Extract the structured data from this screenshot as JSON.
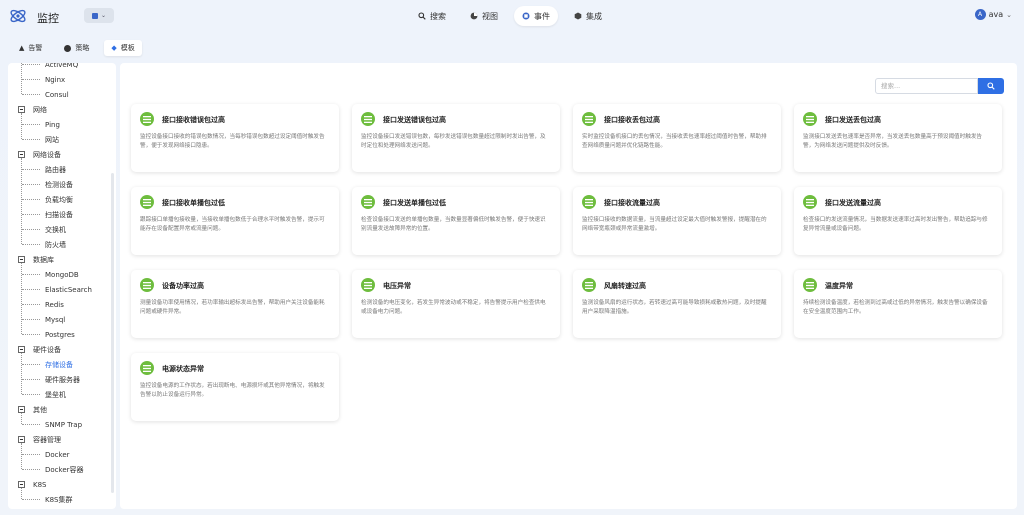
{
  "app": {
    "title": "监控",
    "user_initial": "A",
    "user_name": "ava"
  },
  "nav": [
    {
      "label": "搜索",
      "icon": "search-icon"
    },
    {
      "label": "视图",
      "icon": "chart-pie-icon"
    },
    {
      "label": "事件",
      "icon": "event-icon",
      "active": true
    },
    {
      "label": "集成",
      "icon": "cube-icon"
    }
  ],
  "subtabs": [
    {
      "label": "告警",
      "icon": "bell-icon"
    },
    {
      "label": "策略",
      "icon": "policy-icon"
    },
    {
      "label": "模板",
      "icon": "layers-icon",
      "active": true
    }
  ],
  "search": {
    "placeholder": "搜索..."
  },
  "tree": [
    {
      "type": "leaf",
      "label": "ActiveMQ"
    },
    {
      "type": "leaf",
      "label": "Nginx"
    },
    {
      "type": "leaf",
      "label": "Consul"
    },
    {
      "type": "group",
      "label": "网络"
    },
    {
      "type": "leaf",
      "label": "Ping"
    },
    {
      "type": "leaf",
      "label": "网站"
    },
    {
      "type": "group",
      "label": "网络设备"
    },
    {
      "type": "leaf",
      "label": "路由器"
    },
    {
      "type": "leaf",
      "label": "检测设备"
    },
    {
      "type": "leaf",
      "label": "负载均衡"
    },
    {
      "type": "leaf",
      "label": "扫描设备"
    },
    {
      "type": "leaf",
      "label": "交换机"
    },
    {
      "type": "leaf",
      "label": "防火墙"
    },
    {
      "type": "group",
      "label": "数据库"
    },
    {
      "type": "leaf",
      "label": "MongoDB"
    },
    {
      "type": "leaf",
      "label": "ElasticSearch"
    },
    {
      "type": "leaf",
      "label": "Redis"
    },
    {
      "type": "leaf",
      "label": "Mysql"
    },
    {
      "type": "leaf",
      "label": "Postgres"
    },
    {
      "type": "group",
      "label": "硬件设备"
    },
    {
      "type": "leaf",
      "label": "存储设备",
      "selected": true
    },
    {
      "type": "leaf",
      "label": "硬件服务器"
    },
    {
      "type": "leaf",
      "label": "堡垒机"
    },
    {
      "type": "group",
      "label": "其他"
    },
    {
      "type": "leaf",
      "label": "SNMP Trap"
    },
    {
      "type": "group",
      "label": "容器管理"
    },
    {
      "type": "leaf",
      "label": "Docker"
    },
    {
      "type": "leaf",
      "label": "Docker容器"
    },
    {
      "type": "group",
      "label": "K8S"
    },
    {
      "type": "leaf",
      "label": "K8S集群"
    }
  ],
  "cards": [
    {
      "title": "接口接收错误包过高",
      "desc": "监控设备接口接收的错误包数情况，当每秒错误包数超过设定阈值时触发告警，便于发现网络接口隐患。"
    },
    {
      "title": "接口发送错误包过高",
      "desc": "监控设备接口发送错误包数，每秒发送错误包数量超过限制时发出告警，及时定位和处理网络发送问题。"
    },
    {
      "title": "接口接收丢包过高",
      "desc": "实时监控设备机接口的丢包情况，当接收丢包速率超过阈值时告警，帮助排查网络质量问题并优化链路性能。"
    },
    {
      "title": "接口发送丢包过高",
      "desc": "监测接口发送丢包速率是否异常，当发送丢包数量高于预设阈值时触发告警，为网络发送问题提供及时反馈。"
    },
    {
      "title": "接口接收单播包过低",
      "desc": "跟踪接口单播包接收量，当接收单播包数低于合理水平时触发告警，提示可能存在设备配置异常或流量问题。"
    },
    {
      "title": "接口发送单播包过低",
      "desc": "检查设备接口发送的单播包数量，当数量显著偏低时触发告警，便于快速识别流量发送故障异常的位置。"
    },
    {
      "title": "接口接收流量过高",
      "desc": "监控接口接收的数据流量，当流量超过设定最大值时触发警报，提醒潜在的网络带宽瓶颈或异常流量激增。"
    },
    {
      "title": "接口发送流量过高",
      "desc": "检查接口的发送流量情况，当数据发送速率过高时发出警告，帮助追踪与修复异常流量或设备问题。"
    },
    {
      "title": "设备功率过高",
      "desc": "测量设备功率使用情况，若功率输出超标发出告警，帮助用户关注设备能耗问题或硬件异常。"
    },
    {
      "title": "电压异常",
      "desc": "检测设备的电压变化，若发生异常波动或不稳定，将告警提示用户检查供电或设备电力问题。"
    },
    {
      "title": "风扇转速过高",
      "desc": "监测设备风扇的运行状态，若转速过高可能导致损耗或散热问题，及时提醒用户采取降温措施。"
    },
    {
      "title": "温度异常",
      "desc": "持续检测设备温度，若检测到过高或过低的异常情况，触发告警以确保设备在安全温度范围内工作。"
    },
    {
      "title": "电源状态异常",
      "desc": "监控设备电源的工作状态，若出现断电、电源损坏或其他异常情况，将触发告警以防止设备运行异常。"
    }
  ],
  "colors": {
    "accent": "#2f6fe4",
    "card_icon": "#6ebd3e"
  }
}
